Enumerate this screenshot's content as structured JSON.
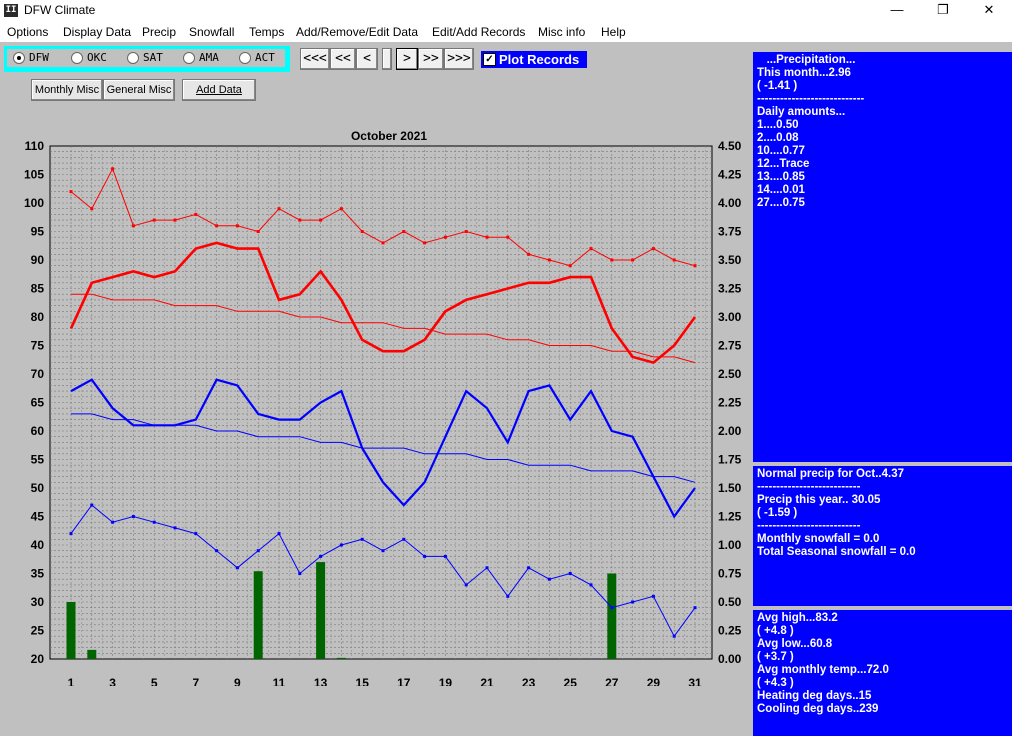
{
  "window": {
    "title": "DFW Climate",
    "icon": "thermometer-app-icon",
    "minimize": "—",
    "restore": "❐",
    "close": "✕"
  },
  "menu": [
    "Options",
    "Display Data",
    "Precip",
    "Snowfall",
    "Temps",
    "Add/Remove/Edit Data",
    "Edit/Add Records",
    "Misc info",
    "Help"
  ],
  "cities": {
    "selected": "DFW",
    "items": [
      "DFW",
      "OKC",
      "SAT",
      "AMA",
      "ACT"
    ]
  },
  "buttons": {
    "monthly_misc": "Monthly Misc",
    "general_misc": "General Misc",
    "add_data": "Add Data"
  },
  "nav": {
    "first": "<<<",
    "prev_many": "<<",
    "prev": "<",
    "next": ">",
    "next_many": ">>",
    "last": ">>>"
  },
  "plot_records": {
    "label": "Plot Records",
    "checked": true,
    "check_glyph": "✓"
  },
  "colors": {
    "high": "#ff0000",
    "low": "#0000ff",
    "precip": "#006400",
    "panel": "#0000ff",
    "city_box": "#00ffff"
  },
  "chart_data": {
    "type": "line",
    "title": "October 2021",
    "x": [
      1,
      2,
      3,
      4,
      5,
      6,
      7,
      8,
      9,
      10,
      11,
      12,
      13,
      14,
      15,
      16,
      17,
      18,
      19,
      20,
      21,
      22,
      23,
      24,
      25,
      26,
      27,
      28,
      29,
      30,
      31
    ],
    "xticks": [
      1,
      3,
      5,
      7,
      9,
      11,
      13,
      15,
      17,
      19,
      21,
      23,
      25,
      27,
      29,
      31
    ],
    "ylim": [
      20,
      110
    ],
    "yticks": [
      20,
      25,
      30,
      35,
      40,
      45,
      50,
      55,
      60,
      65,
      70,
      75,
      80,
      85,
      90,
      95,
      100,
      105,
      110
    ],
    "y2lim": [
      0,
      4.5
    ],
    "y2ticks": [
      "0.00",
      "0.25",
      "0.50",
      "0.75",
      "1.00",
      "1.25",
      "1.50",
      "1.75",
      "2.00",
      "2.25",
      "2.50",
      "2.75",
      "3.00",
      "3.25",
      "3.50",
      "3.75",
      "4.00",
      "4.25",
      "4.50"
    ],
    "grid": true,
    "series": [
      {
        "key": "record_high",
        "values": [
          102,
          99,
          106,
          96,
          97,
          97,
          98,
          96,
          96,
          95,
          99,
          97,
          97,
          99,
          95,
          93,
          95,
          93,
          94,
          95,
          94,
          94,
          91,
          90,
          89,
          92,
          90,
          90,
          92,
          90,
          89
        ]
      },
      {
        "key": "high",
        "values": [
          78,
          86,
          87,
          88,
          87,
          88,
          92,
          93,
          92,
          92,
          83,
          84,
          88,
          83,
          76,
          74,
          74,
          76,
          81,
          83,
          84,
          85,
          86,
          86,
          87,
          87,
          78,
          73,
          72,
          75,
          80
        ]
      },
      {
        "key": "normal_high",
        "values": [
          84,
          84,
          83,
          83,
          83,
          82,
          82,
          82,
          81,
          81,
          81,
          80,
          80,
          79,
          79,
          79,
          78,
          78,
          77,
          77,
          77,
          76,
          76,
          75,
          75,
          75,
          74,
          74,
          73,
          73,
          72
        ]
      },
      {
        "key": "low",
        "values": [
          67,
          69,
          64,
          61,
          61,
          61,
          62,
          69,
          68,
          63,
          62,
          62,
          65,
          67,
          57,
          51,
          47,
          51,
          59,
          67,
          64,
          58,
          67,
          68,
          62,
          67,
          60,
          59,
          52,
          45,
          50
        ]
      },
      {
        "key": "normal_low",
        "values": [
          63,
          63,
          62,
          62,
          61,
          61,
          61,
          60,
          60,
          59,
          59,
          59,
          58,
          58,
          57,
          57,
          57,
          56,
          56,
          56,
          55,
          55,
          54,
          54,
          54,
          53,
          53,
          53,
          52,
          52,
          51
        ]
      },
      {
        "key": "record_low",
        "values": [
          42,
          47,
          44,
          45,
          44,
          43,
          42,
          39,
          36,
          39,
          42,
          35,
          38,
          40,
          41,
          39,
          41,
          38,
          38,
          33,
          36,
          31,
          36,
          34,
          35,
          33,
          29,
          30,
          31,
          24,
          29
        ]
      }
    ],
    "precip": {
      "days": [
        1,
        2,
        10,
        12,
        13,
        14,
        27
      ],
      "values": [
        0.5,
        0.08,
        0.77,
        0,
        0.85,
        0.01,
        0.75
      ]
    }
  },
  "precip_panel": [
    "   ...Precipitation...",
    "This month...2.96",
    "( -1.41 )",
    "----------------------------",
    "Daily amounts...",
    "1....0.50",
    "2....0.08",
    "10....0.77",
    "12...Trace",
    "13....0.85",
    "14....0.01",
    "27....0.75"
  ],
  "normals_panel": [
    "Normal precip for Oct..4.37",
    "---------------------------",
    "Precip this year.. 30.05",
    "( -1.59 )",
    "---------------------------",
    "Monthly snowfall = 0.0",
    "Total Seasonal snowfall = 0.0"
  ],
  "temps_panel": [
    "Avg high...83.2",
    "( +4.8 )",
    "Avg low...60.8",
    "( +3.7 )",
    "Avg monthly temp...72.0",
    "( +4.3 )",
    "Heating deg days..15",
    "Cooling deg days..239"
  ]
}
